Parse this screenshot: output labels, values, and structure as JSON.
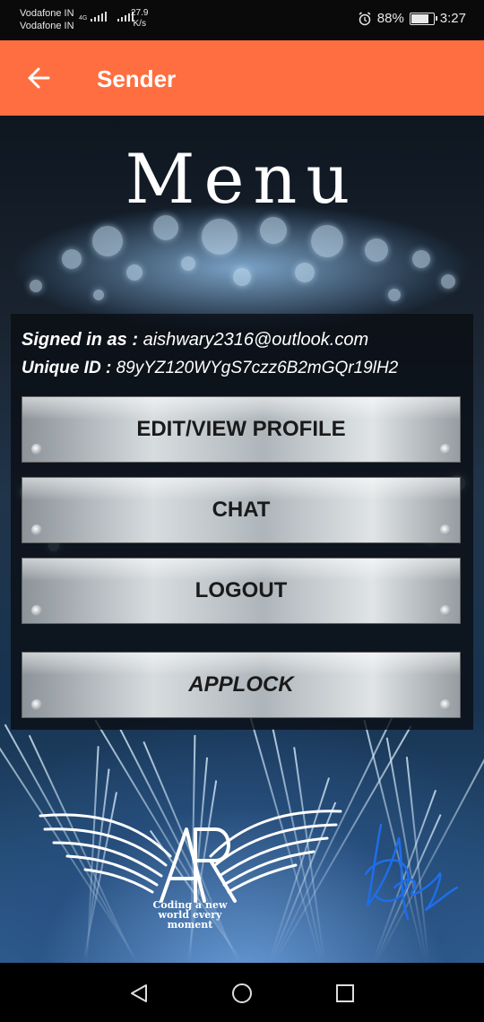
{
  "status_bar": {
    "carrier_1": "Vodafone IN",
    "carrier_2": "Vodafone IN",
    "network_type": "4G",
    "speed_value": "27.9",
    "speed_unit": "K/s",
    "battery_percent": "88%",
    "battery_level": 0.88,
    "time": "3:27"
  },
  "app_bar": {
    "title": "Sender",
    "background_color": "#ff6e40"
  },
  "menu": {
    "title": "Menu",
    "signed_in_label": "Signed in as :",
    "signed_in_value": "aishwary2316@outlook.com",
    "unique_id_label": "Unique ID :",
    "unique_id_value": "89yYZ120WYgS7czz6B2mGQr19lH2",
    "buttons": {
      "edit_profile": "EDIT/VIEW PROFILE",
      "chat": "CHAT",
      "logout": "LOGOUT",
      "applock": "APPLOCK"
    }
  },
  "logo": {
    "monogram": "AR",
    "tagline": "Coding a new world every moment"
  },
  "signature": {
    "text": "AR"
  }
}
